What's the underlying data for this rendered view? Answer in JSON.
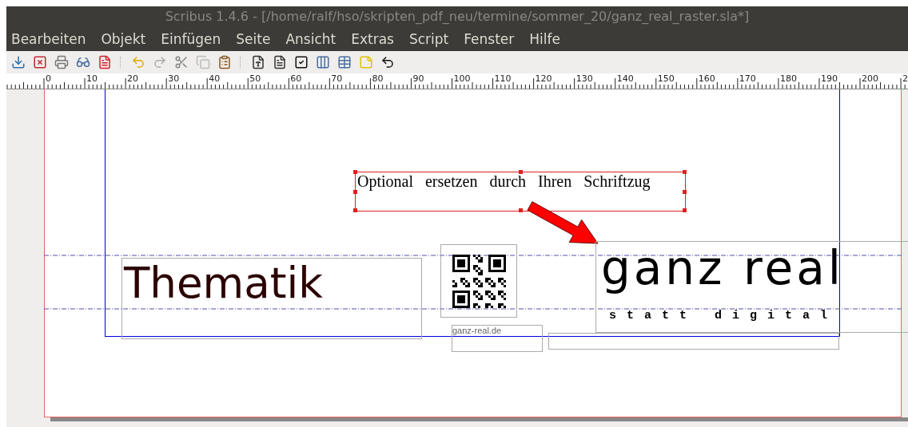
{
  "window": {
    "title": "Scribus 1.4.6 - [/home/ralf/hso/skripten_pdf_neu/termine/sommer_20/ganz_real_raster.sla*]"
  },
  "menu": [
    "Bearbeiten",
    "Objekt",
    "Einfügen",
    "Seite",
    "Ansicht",
    "Extras",
    "Script",
    "Fenster",
    "Hilfe"
  ],
  "ruler": {
    "labels": [
      "0",
      "10",
      "20",
      "30",
      "40",
      "50",
      "60",
      "70",
      "80",
      "90",
      "100",
      "110",
      "120",
      "130",
      "140",
      "150",
      "160",
      "170",
      "180",
      "190",
      "200",
      "2"
    ]
  },
  "canvas": {
    "subtitle_frame": {
      "text": "Optional ersetzen durch Ihren Schriftzug",
      "selected": true
    },
    "heading": "Thematik",
    "url": "ganz-real.de",
    "logo": {
      "title": "ganz real",
      "tagline": "statt digital"
    }
  }
}
